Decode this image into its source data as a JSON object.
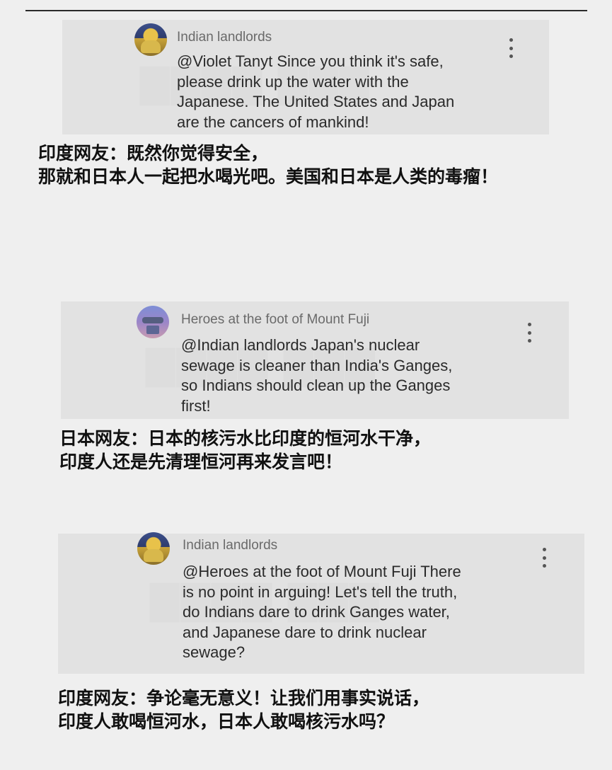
{
  "comments": [
    {
      "author": "Indian landlords",
      "text": "@Violet Tanyt Since you think it's safe,\nplease drink up the water with the\nJapanese. The United States and Japan\nare the cancers of mankind!",
      "caption": "印度网友：既然你觉得安全，\n那就和日本人一起把水喝光吧。美国和日本是人类的毒瘤！"
    },
    {
      "author": "Heroes at the foot of Mount Fuji",
      "text": "@Indian landlords Japan's nuclear\nsewage is cleaner than India's Ganges,\nso Indians should clean up the Ganges\nfirst!",
      "caption": "日本网友：日本的核污水比印度的恒河水干净，\n印度人还是先清理恒河再来发言吧！"
    },
    {
      "author": "Indian landlords",
      "text": "@Heroes at the foot of Mount Fuji There\nis no point in arguing! Let's tell the truth,\ndo Indians dare to drink Ganges water,\nand Japanese dare to drink nuclear\nsewage?",
      "caption": "印度网友：争论毫无意义！让我们用事实说话，\n印度人敢喝恒河水，日本人敢喝核污水吗？"
    }
  ],
  "icons": {
    "menu": "more-vert-icon",
    "avatar_1": "avatar-indian-landlords",
    "avatar_2": "avatar-heroes-mount-fuji"
  },
  "colors": {
    "background": "#efefef",
    "card": "#e2e2e2",
    "author": "#6a6a6a",
    "caption": "#111111"
  }
}
